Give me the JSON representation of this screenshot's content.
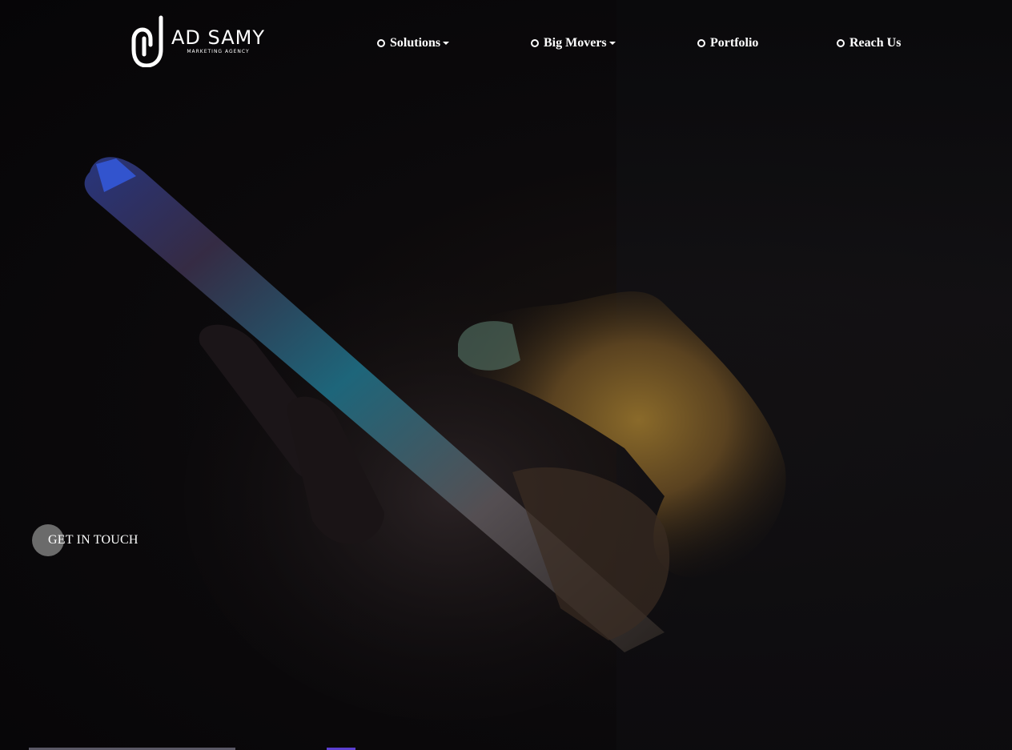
{
  "brand": {
    "name": "AD SAMY",
    "tagline": "MARKETING AGENCY"
  },
  "nav": {
    "items": [
      {
        "label": "Solutions",
        "has_dropdown": true
      },
      {
        "label": "Big Movers",
        "has_dropdown": true
      },
      {
        "label": "Portfolio",
        "has_dropdown": false
      },
      {
        "label": "Reach Us",
        "has_dropdown": false
      }
    ]
  },
  "hero": {
    "cta_label": "GET IN TOUCH",
    "background_icon": "hand-holding-phone-photo"
  },
  "colors": {
    "background": "#050406",
    "text": "#ffffff",
    "cta_circle": "#6b6b6b",
    "accent": "#5b3fd0"
  }
}
